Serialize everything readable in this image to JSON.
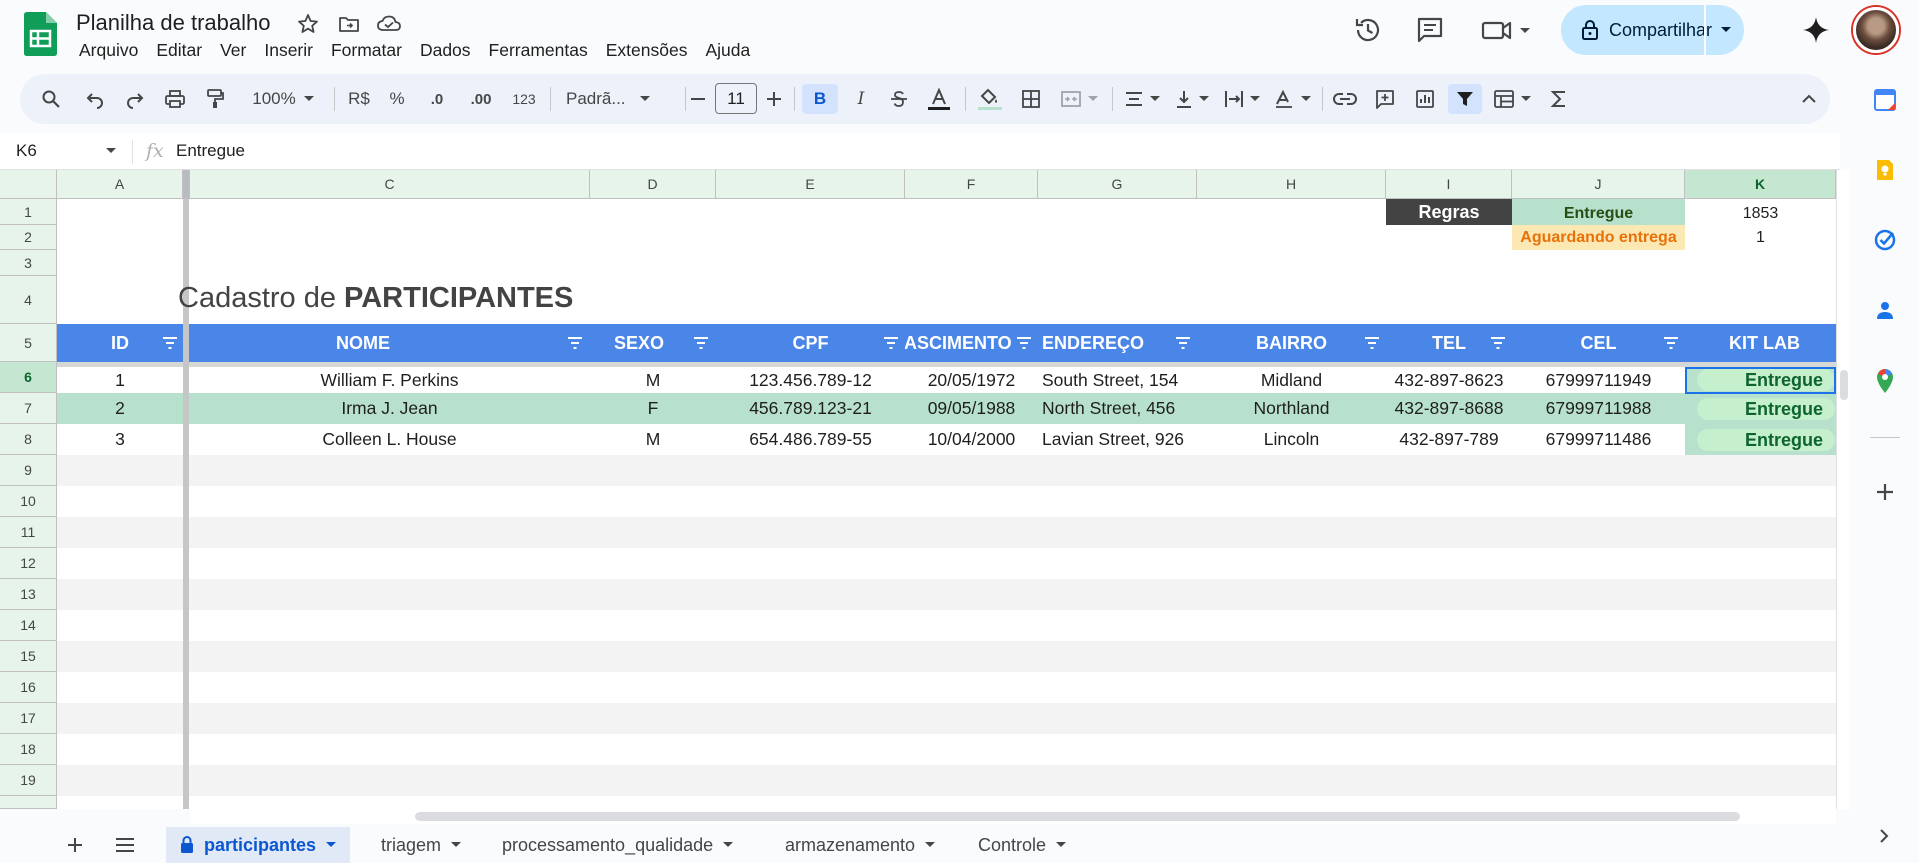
{
  "app": {
    "title": "Planilha de trabalho",
    "menu": [
      "Arquivo",
      "Editar",
      "Ver",
      "Inserir",
      "Formatar",
      "Dados",
      "Ferramentas",
      "Extensões",
      "Ajuda"
    ],
    "share_label": "Compartilhar"
  },
  "toolbar": {
    "zoom": "100%",
    "currency": "R$",
    "percent": "%",
    "dec_decrease": ".0",
    "dec_increase": ".00",
    "number_format": "123",
    "font": "Padrã...",
    "font_size": "11"
  },
  "formula_bar": {
    "cell_ref": "K6",
    "fx": "fx",
    "content": "Entregue"
  },
  "columns": [
    "A",
    "C",
    "D",
    "E",
    "F",
    "G",
    "H",
    "I",
    "J",
    "K"
  ],
  "rows": [
    "1",
    "2",
    "3",
    "4",
    "5",
    "6",
    "7",
    "8",
    "9",
    "10",
    "11",
    "12",
    "13",
    "14",
    "15",
    "16",
    "17",
    "18",
    "19"
  ],
  "rules": {
    "label": "Regras",
    "delivered_label": "Entregue",
    "delivered_count": "1853",
    "pending_label": "Aguardando entrega",
    "pending_count": "1"
  },
  "sheet_title": {
    "prefix": "Cadastro de ",
    "bold": "PARTICIPANTES"
  },
  "table": {
    "headers": [
      "ID",
      "NOME",
      "SEXO",
      "CPF",
      "NASCIMENTO",
      "ENDEREÇO",
      "BAIRRO",
      "TEL",
      "CEL",
      "KIT LAB"
    ],
    "rows": [
      [
        "1",
        "William F. Perkins",
        "M",
        "123.456.789-12",
        "20/05/1972",
        "South Street, 154",
        "Midland",
        "432-897-8623",
        "67999711949",
        "Entregue"
      ],
      [
        "2",
        "Irma J. Jean",
        "F",
        "456.789.123-21",
        "09/05/1988",
        "North Street, 456",
        "Northland",
        "432-897-8688",
        "67999711988",
        "Entregue"
      ],
      [
        "3",
        "Colleen L. House",
        "M",
        "654.486.789-55",
        "10/04/2000",
        "Lavian Street, 926",
        "Lincoln",
        "432-897-789",
        "67999711486",
        "Entregue"
      ]
    ]
  },
  "sheet_tabs": [
    "participantes",
    "triagem",
    "processamento_qualidade",
    "armazenamento",
    "Controle"
  ],
  "colors": {
    "header_blue": "#4a86e8",
    "band_green": "#b7e1cd",
    "delivered_bg": "#b7e1cd",
    "pending_bg": "#fce8b2",
    "pending_text": "#e8710a",
    "rules_bg": "#434343"
  }
}
